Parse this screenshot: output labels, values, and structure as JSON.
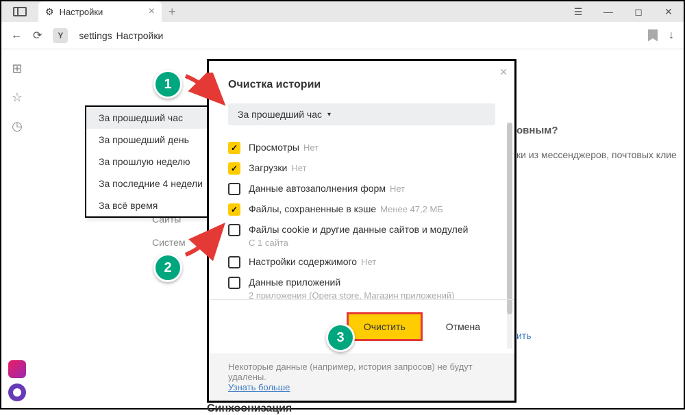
{
  "titlebar": {
    "tab_title": "Настройки",
    "window_buttons": [
      "≡",
      "—",
      "◻",
      "✕"
    ]
  },
  "addressbar": {
    "url_prefix": "settings",
    "url_text": "Настройки"
  },
  "background": {
    "heading_fragment": "овным?",
    "text_fragment": "ки из мессенджеров, почтовых клие",
    "link_fragment": "ить",
    "sync_fragment": "Синхоонизация"
  },
  "settings_nav": {
    "item1": "Сайты",
    "item2": "Систем"
  },
  "dropdown": {
    "items": [
      "За прошедший час",
      "За прошедший день",
      "За прошлую неделю",
      "За последние 4 недели",
      "За всё время"
    ]
  },
  "dialog": {
    "title": "Очистка истории",
    "range_label": "За прошедший час",
    "items": [
      {
        "label": "Просмотры",
        "hint": "Нет",
        "checked": true
      },
      {
        "label": "Загрузки",
        "hint": "Нет",
        "checked": true
      },
      {
        "label": "Данные автозаполнения форм",
        "hint": "Нет",
        "checked": false
      },
      {
        "label": "Файлы, сохраненные в кэше",
        "hint": "Менее 47,2 МБ",
        "checked": true
      },
      {
        "label": "Файлы cookie и другие данные сайтов и модулей",
        "sub": "С 1 сайта",
        "checked": false
      },
      {
        "label": "Настройки содержимого",
        "hint": "Нет",
        "checked": false
      },
      {
        "label": "Данные приложений",
        "sub": "2 приложения (Opera store, Магазин приложений)",
        "checked": false
      }
    ],
    "clear_btn": "Очистить",
    "cancel_btn": "Отмена",
    "note_text": "Некоторые данные (например, история запросов) не будут удалены.",
    "note_link": "Узнать больше"
  },
  "annotations": {
    "n1": "1",
    "n2": "2",
    "n3": "3"
  }
}
